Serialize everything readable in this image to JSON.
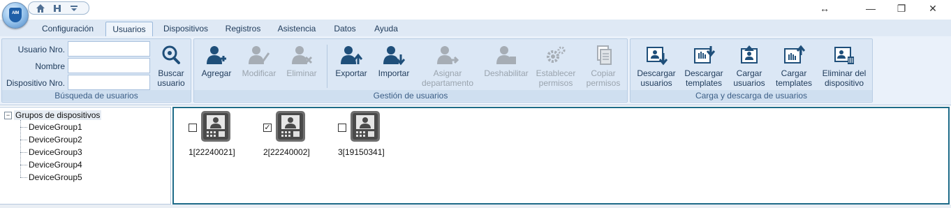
{
  "window": {
    "logo_text": "AIM",
    "controls": {
      "restore_cursor": "↔",
      "minimize": "—",
      "maximize": "❐",
      "close": "✕"
    }
  },
  "tabs": [
    {
      "label": "Configuración",
      "active": false
    },
    {
      "label": "Usuarios",
      "active": true
    },
    {
      "label": "Dispositivos",
      "active": false
    },
    {
      "label": "Registros",
      "active": false
    },
    {
      "label": "Asistencia",
      "active": false
    },
    {
      "label": "Datos",
      "active": false
    },
    {
      "label": "Ayuda",
      "active": false
    }
  ],
  "search_group": {
    "label": "Búsqueda de usuarios",
    "fields": [
      {
        "label": "Usuario Nro.",
        "value": ""
      },
      {
        "label": "Nombre",
        "value": ""
      },
      {
        "label": "Dispositivo Nro.",
        "value": ""
      }
    ],
    "button": {
      "line1": "Buscar",
      "line2": "usuario",
      "icon": "search-icon"
    }
  },
  "manage_group": {
    "label": "Gestión de usuarios",
    "buttons": [
      {
        "line1": "Agregar",
        "line2": "",
        "icon": "add-user-icon",
        "enabled": true
      },
      {
        "line1": "Modificar",
        "line2": "",
        "icon": "edit-user-icon",
        "enabled": false
      },
      {
        "line1": "Eliminar",
        "line2": "",
        "icon": "delete-user-icon",
        "enabled": false
      },
      {
        "line1": "Exportar",
        "line2": "",
        "icon": "export-user-icon",
        "enabled": true
      },
      {
        "line1": "Importar",
        "line2": "",
        "icon": "import-user-icon",
        "enabled": true
      },
      {
        "line1": "Asignar",
        "line2": "departamento",
        "icon": "assign-department-icon",
        "enabled": false
      },
      {
        "line1": "Deshabilitar",
        "line2": "",
        "icon": "disable-user-icon",
        "enabled": false
      },
      {
        "line1": "Establecer",
        "line2": "permisos",
        "icon": "permissions-gear-icon",
        "enabled": false
      },
      {
        "line1": "Copiar",
        "line2": "permisos",
        "icon": "copy-permissions-icon",
        "enabled": false
      }
    ]
  },
  "transfer_group": {
    "label": "Carga y descarga de usuarios",
    "buttons": [
      {
        "line1": "Descargar",
        "line2": "usuarios",
        "icon": "download-users-icon",
        "enabled": true
      },
      {
        "line1": "Descargar",
        "line2": "templates",
        "icon": "download-templates-icon",
        "enabled": true
      },
      {
        "line1": "Cargar",
        "line2": "usuarios",
        "icon": "upload-users-icon",
        "enabled": true
      },
      {
        "line1": "Cargar",
        "line2": "templates",
        "icon": "upload-templates-icon",
        "enabled": true
      },
      {
        "line1": "Eliminar del",
        "line2": "dispositivo",
        "icon": "delete-from-device-icon",
        "enabled": true
      }
    ]
  },
  "tree": {
    "root": {
      "label": "Grupos de dispositivos",
      "expander": "−"
    },
    "items": [
      "DeviceGroup1",
      "DeviceGroup2",
      "DeviceGroup3",
      "DeviceGroup4",
      "DeviceGroup5"
    ]
  },
  "devices": [
    {
      "label": "1[22240021]",
      "checked": false
    },
    {
      "label": "2[22240002]",
      "checked": true
    },
    {
      "label": "3[19150341]",
      "checked": false
    }
  ],
  "colors": {
    "accent_blue": "#1f5fa8",
    "icon_dark_blue": "#1f4f7a",
    "icon_disabled": "#a6adb5",
    "device_panel_border": "#1e6b88"
  }
}
